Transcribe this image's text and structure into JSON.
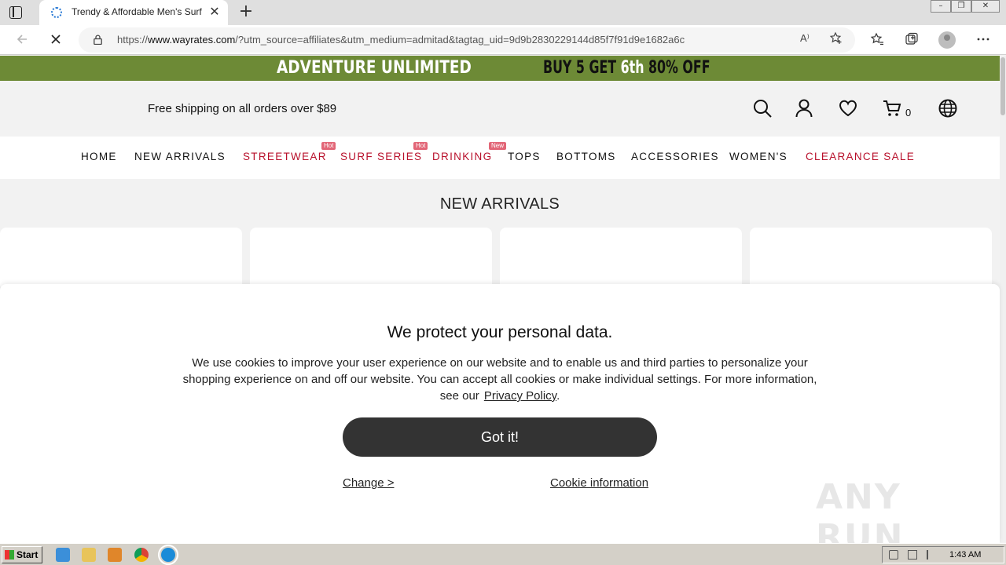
{
  "browser": {
    "tab_title": "Trendy & Affordable Men's Surf",
    "tab_close": "✕",
    "new_tab": "+",
    "url_prefix": "https://",
    "url_host": "www.wayrates.com",
    "url_rest": "/?utm_source=affiliates&utm_medium=admitad&tagtag_uid=9d9b2830229144d85f7f91d9e1682a6c",
    "read_aloud": "A⁾",
    "window_controls": {
      "minimize": "–",
      "maximize": "❐",
      "close": "✕"
    },
    "icons": [
      "tab-actions-icon",
      "back-arrow-icon",
      "stop-loading-icon",
      "lock-icon",
      "read-aloud-icon",
      "add-favorite-icon",
      "favorites-icon",
      "collections-icon",
      "profile-icon",
      "more-menu-icon"
    ]
  },
  "promo": {
    "left": "ADVENTURE UNLIMITED",
    "right_a": "BUY 5 GET ",
    "right_b": "6th",
    "right_c": " 80% OFF",
    "color": "#6d8a36"
  },
  "header": {
    "shipping": "Free shipping on all orders over $89",
    "cart_count": "0",
    "icons": [
      "search-icon",
      "account-icon",
      "wishlist-heart-icon",
      "cart-icon",
      "language-globe-icon"
    ]
  },
  "nav": {
    "items": [
      {
        "label": "HOME"
      },
      {
        "label": "NEW ARRIVALS"
      },
      {
        "label": "STREETWEAR",
        "badge": "Hot"
      },
      {
        "label": "SURF SERIES",
        "badge": "Hot"
      },
      {
        "label": "DRINKING",
        "badge": "New"
      },
      {
        "label": "TOPS"
      },
      {
        "label": "BOTTOMS"
      },
      {
        "label": "ACCESSORIES"
      },
      {
        "label": "WOMEN'S"
      },
      {
        "label": "CLEARANCE SALE"
      }
    ],
    "accent": "#b8102b"
  },
  "section": {
    "title": "NEW ARRIVALS"
  },
  "cookie": {
    "title": "We protect your personal data.",
    "body": "We use cookies to improve your user experience on our website and to enable us and third parties to personalize your shopping experience on and off our website. You can accept all cookies or make individual settings. For more information, see our",
    "privacy_link": "Privacy Policy",
    "period": ".",
    "accept": "Got it!",
    "change": "Change >",
    "info": "Cookie information"
  },
  "watermark": "ANY RUN",
  "taskbar": {
    "start": "Start",
    "clock": "1:43 AM",
    "icons": [
      "internet-explorer-icon",
      "file-explorer-icon",
      "media-player-icon",
      "chrome-icon",
      "edge-icon"
    ]
  }
}
